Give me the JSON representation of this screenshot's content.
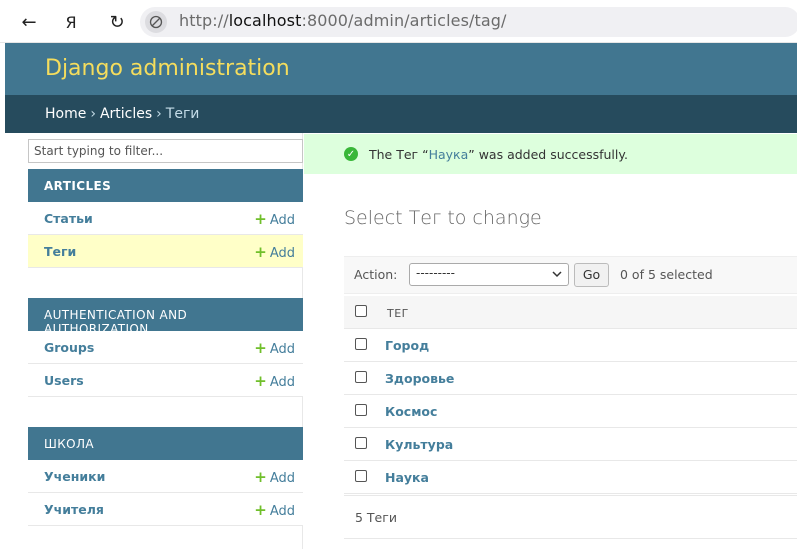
{
  "browser": {
    "back_icon": "←",
    "yandex_icon": "Я",
    "reload_icon": "↻",
    "url_prefix": "http://",
    "url_host": "localhost",
    "url_rest": ":8000/admin/articles/tag/"
  },
  "header": {
    "branding": "Django administration"
  },
  "breadcrumbs": {
    "home": "Home",
    "articles": "Articles",
    "current": "Теги",
    "separator": "›"
  },
  "sidebar": {
    "filter_placeholder": "Start typing to filter...",
    "add_label": "Add",
    "modules": [
      {
        "caption": "ARTICLES",
        "models": [
          {
            "name": "Статьи"
          },
          {
            "name": "Теги"
          }
        ]
      },
      {
        "caption": "AUTHENTICATION AND AUTHORIZATION",
        "models": [
          {
            "name": "Groups"
          },
          {
            "name": "Users"
          }
        ]
      },
      {
        "caption": "ШКОЛА",
        "models": [
          {
            "name": "Ученики"
          },
          {
            "name": "Учителя"
          }
        ]
      }
    ]
  },
  "message": {
    "prefix": "The Тег “",
    "link": "Наука",
    "suffix": "” was added successfully.",
    "icon": "check-circle-icon"
  },
  "main": {
    "title": "Select Тег to change",
    "action_label": "Action:",
    "action_value": "---------",
    "go_label": "Go",
    "selected_count": "0 of 5 selected",
    "column_header": "ТЕГ",
    "rows": [
      "Город",
      "Здоровье",
      "Космос",
      "Культура",
      "Наука"
    ],
    "result_count": "5 Теги"
  },
  "colors": {
    "header_bg": "#417690",
    "breadcrumbs_bg": "#264b5d",
    "branding": "#f5dd5d",
    "link": "#447e9b",
    "success_bg": "#ddffdd",
    "add_plus": "#70bf2b",
    "active_row": "#ffffc8"
  }
}
